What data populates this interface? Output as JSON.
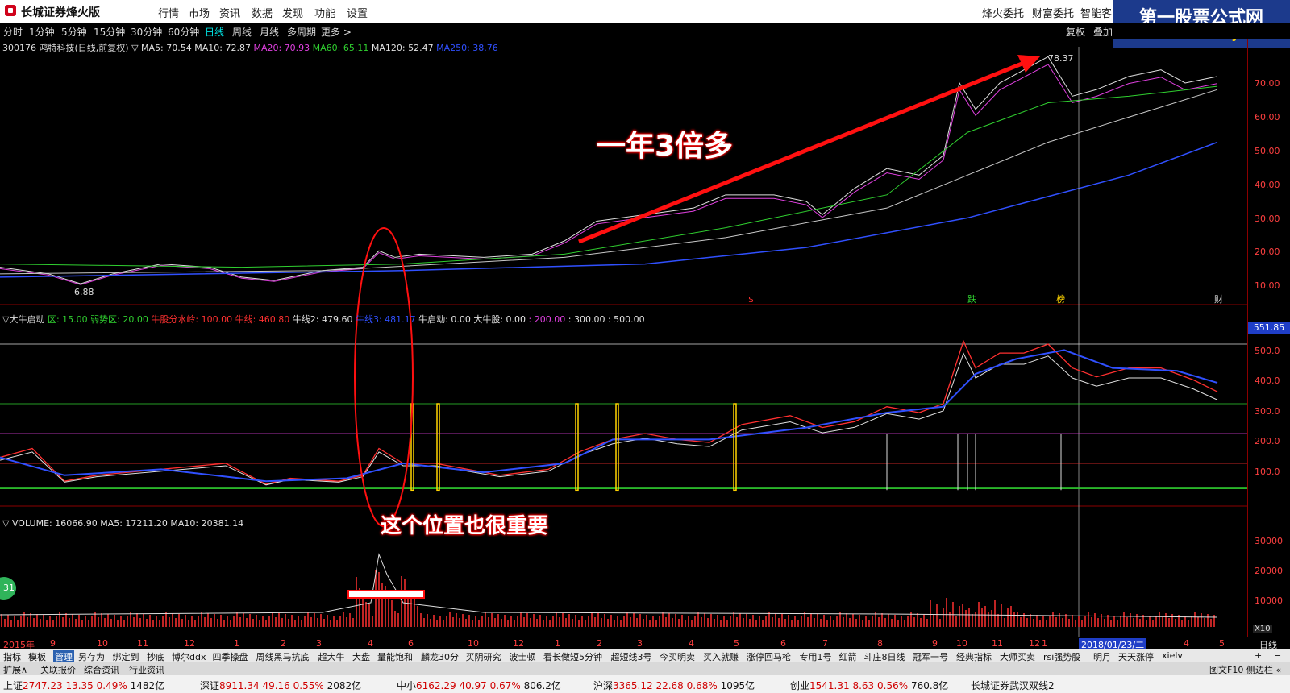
{
  "titlebar": {
    "app_title": "长城证券烽火版",
    "menu": [
      "行情",
      "市场",
      "资讯",
      "数据",
      "发现",
      "功能",
      "设置"
    ],
    "right_links": [
      "烽火委托",
      "财富委托",
      "智能客"
    ]
  },
  "watermark": {
    "title": "第一股票公式网",
    "url": "www.chnmoney.com"
  },
  "periodbar": {
    "periods": [
      "分时",
      "1分钟",
      "5分钟",
      "15分钟",
      "30分钟",
      "60分钟",
      "日线",
      "周线",
      "月线",
      "多周期",
      "更多 >"
    ],
    "active": "日线",
    "right_buttons": [
      "复权",
      "叠加"
    ]
  },
  "price_panel": {
    "stock": "300176 鸿特科技(日线,前复权)",
    "indicators": [
      {
        "label": "MA5: 70.54",
        "color": "#e0e0e0"
      },
      {
        "label": "MA10: 72.87",
        "color": "#e0e0e0"
      },
      {
        "label": "MA20: 70.93",
        "color": "#e040e0"
      },
      {
        "label": "MA60: 65.11",
        "color": "#30d030"
      },
      {
        "label": "MA120: 52.47",
        "color": "#e0e0e0"
      },
      {
        "label": "MA250: 38.76",
        "color": "#3050ff"
      }
    ],
    "axis": [
      "70.00",
      "60.00",
      "50.00",
      "40.00",
      "30.00",
      "20.00",
      "10.00"
    ],
    "high_label": "78.37",
    "low_label": "6.88",
    "markers": [
      "$",
      "跌",
      "榜",
      "财"
    ]
  },
  "indicator_panel": {
    "title": "大牛启动",
    "items": [
      {
        "label": "区: 15.00",
        "color": "#30d030"
      },
      {
        "label": "弱势区: 20.00",
        "color": "#30d030"
      },
      {
        "label": "牛股分水岭: 100.00",
        "color": "#ff3030"
      },
      {
        "label": "牛线: 460.80",
        "color": "#ff3030"
      },
      {
        "label": "牛线2: 479.60",
        "color": "#e0e0e0"
      },
      {
        "label": "牛线3: 481.17",
        "color": "#3050ff"
      },
      {
        "label": "牛启动: 0.00",
        "color": "#e0e0e0"
      },
      {
        "label": "大牛股: 0.00",
        "color": "#e0e0e0"
      },
      {
        "label": ": 200.00",
        "color": "#e040e0"
      },
      {
        "label": ": 300.00",
        "color": "#e0e0e0"
      },
      {
        "label": ": 500.00",
        "color": "#e0e0e0"
      }
    ],
    "axis": [
      "500.0",
      "400.0",
      "300.0",
      "200.0",
      "100.0"
    ],
    "current": "551.85"
  },
  "volume_panel": {
    "items": [
      {
        "label": "VOLUME: 16066.90",
        "color": "#e0e0e0"
      },
      {
        "label": "MA5: 17211.20",
        "color": "#e0e0e0"
      },
      {
        "label": "MA10: 20381.14",
        "color": "#e0e0e0"
      }
    ],
    "axis": [
      "30000",
      "20000",
      "10000"
    ],
    "unit": "X10",
    "badge": "31"
  },
  "annotations": {
    "main": "一年3倍多",
    "note": "这个位置也很重要"
  },
  "datebar": {
    "dates": [
      "2015年",
      "9",
      "10",
      "11",
      "12",
      "1",
      "2",
      "3",
      "4",
      "6",
      "10",
      "12",
      "1",
      "2",
      "3",
      "4",
      "5",
      "6",
      "7",
      "8",
      "9",
      "10",
      "11",
      "12",
      "1",
      "2018/01/23/二",
      "4",
      "5"
    ],
    "right": "日线"
  },
  "tabs": [
    "指标",
    "模板",
    "管理",
    "另存为",
    "绑定到",
    "抄底",
    "博尔ddx",
    "四季操盘",
    "周线黑马抗底",
    "超大牛",
    "大盘",
    "量能饱和",
    "麟龙30分",
    "买阴研究",
    "波士顿",
    "看长做短5分钟",
    "超短线3号",
    "今买明卖",
    "买入就赚",
    "涨停回马枪",
    "专用1号",
    "红箭",
    "斗庄8日线",
    "冠军一号",
    "经典指标",
    "大师买卖",
    "rsi强势股",
    "明月",
    "天天涨停",
    "xielv"
  ],
  "active_tab": "管理",
  "links": [
    "扩展∧",
    "关联报价",
    "综合资讯",
    "行业资讯"
  ],
  "link_right": [
    "图文F10",
    "侧边栏 «"
  ],
  "status": [
    {
      "name": "上证",
      "price": "2747.23",
      "chg": "13.35",
      "pct": "0.49%",
      "amt": "1482亿"
    },
    {
      "name": "深证",
      "price": "8911.34",
      "chg": "49.16",
      "pct": "0.55%",
      "amt": "2082亿"
    },
    {
      "name": "中小",
      "price": "6162.29",
      "chg": "40.97",
      "pct": "0.67%",
      "amt": "806.2亿"
    },
    {
      "name": "沪深",
      "price": "3365.12",
      "chg": "22.68",
      "pct": "0.68%",
      "amt": "1095亿"
    },
    {
      "name": "创业",
      "price": "1541.31",
      "chg": "8.63",
      "pct": "0.56%",
      "amt": "760.8亿"
    }
  ],
  "status_right": "长城证券武汉双线2"
}
